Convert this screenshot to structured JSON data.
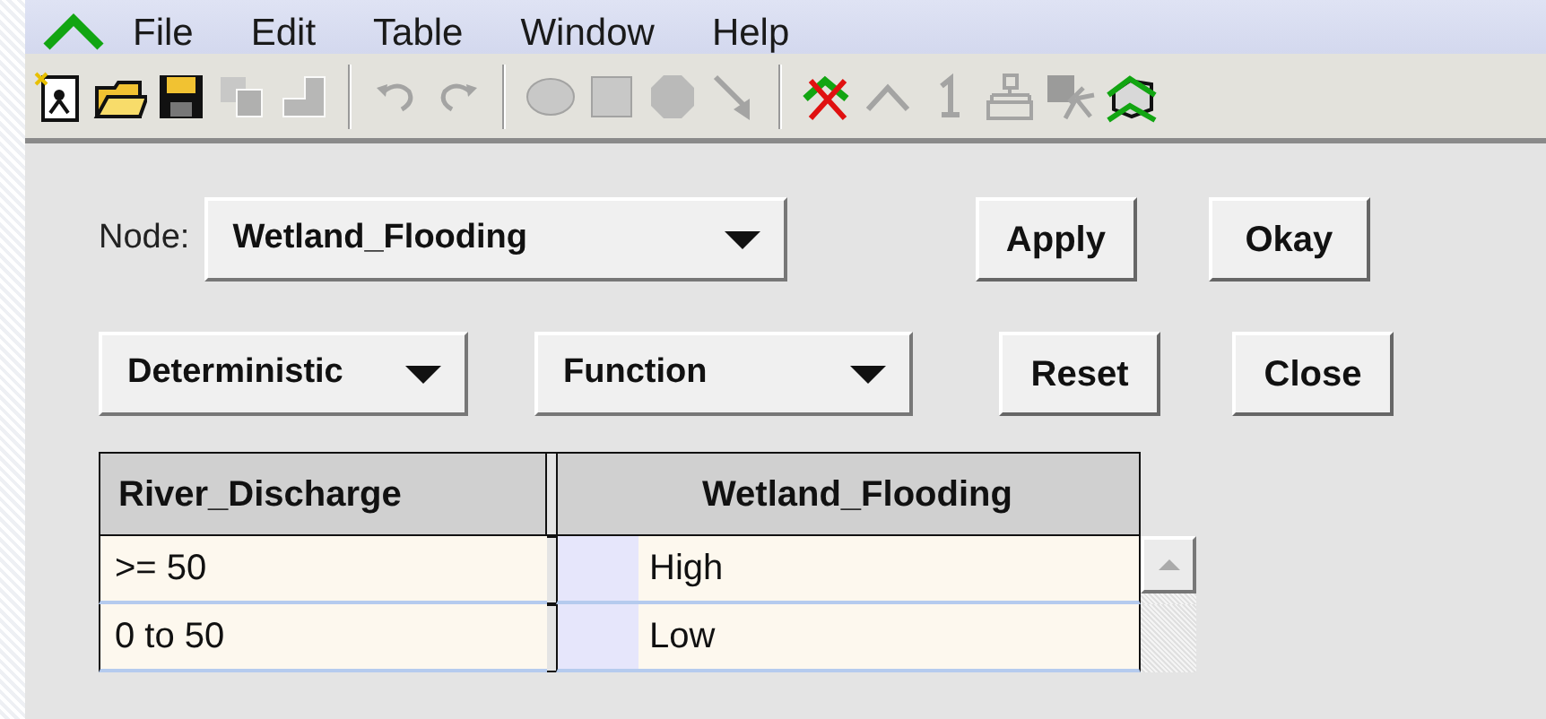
{
  "menu_bar": {
    "items": [
      "File",
      "Edit",
      "Table",
      "Window",
      "Help"
    ]
  },
  "toolbar": [
    {
      "kind": "new",
      "disabled": false
    },
    {
      "kind": "open",
      "disabled": false
    },
    {
      "kind": "save",
      "disabled": false
    },
    {
      "kind": "copy",
      "disabled": true
    },
    {
      "kind": "paste",
      "disabled": true
    },
    {
      "kind": "sep"
    },
    {
      "kind": "undo",
      "disabled": true
    },
    {
      "kind": "redo",
      "disabled": true
    },
    {
      "kind": "sep"
    },
    {
      "kind": "ellipse",
      "disabled": true
    },
    {
      "kind": "square",
      "disabled": true
    },
    {
      "kind": "octagon",
      "disabled": true
    },
    {
      "kind": "arrow",
      "disabled": true
    },
    {
      "kind": "sep"
    },
    {
      "kind": "cross",
      "disabled": false
    },
    {
      "kind": "caret",
      "disabled": true
    },
    {
      "kind": "one",
      "disabled": true
    },
    {
      "kind": "tree",
      "disabled": true
    },
    {
      "kind": "node",
      "disabled": true
    },
    {
      "kind": "cube",
      "disabled": false
    }
  ],
  "dialog": {
    "node_label": "Node:",
    "node_value": "Wetland_Flooding",
    "type_value": "Deterministic",
    "kind_value": "Function",
    "buttons": [
      {
        "label": "Apply",
        "kind": "apply"
      },
      {
        "label": "Okay",
        "kind": "okay"
      },
      {
        "label": "Reset",
        "kind": "reset"
      },
      {
        "label": "Close",
        "kind": "close"
      }
    ]
  },
  "table": {
    "columns": [
      "River_Discharge",
      "Wetland_Flooding"
    ],
    "rows": [
      [
        ">= 50",
        "High"
      ],
      [
        "0 to 50",
        "Low"
      ]
    ]
  }
}
